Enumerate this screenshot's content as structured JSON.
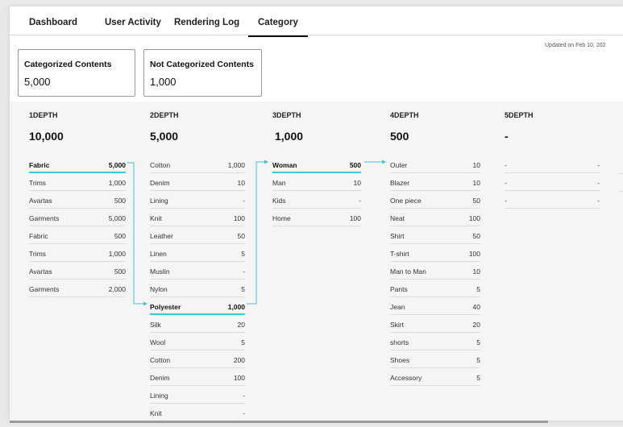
{
  "tabs": [
    "Dashboard",
    "User Activity",
    "Rendering Log",
    "Category"
  ],
  "updated": "Updated on Feb 10, 202",
  "cards": [
    {
      "title": "Categorized Contents",
      "value": "5,000"
    },
    {
      "title": "Not Categorized Contents",
      "value": "1,000"
    }
  ],
  "columns": [
    {
      "label": "1DEPTH",
      "total": "10,000",
      "rows": [
        {
          "name": "Fabric",
          "value": "5,000"
        },
        {
          "name": "Trims",
          "value": "1,000"
        },
        {
          "name": "Avartas",
          "value": "500"
        },
        {
          "name": "Garments",
          "value": "5,000"
        },
        {
          "name": "Fabric",
          "value": "500"
        },
        {
          "name": "Trims",
          "value": "1,000"
        },
        {
          "name": "Avartas",
          "value": "500"
        },
        {
          "name": "Garments",
          "value": "2,000"
        }
      ]
    },
    {
      "label": "2DEPTH",
      "total": "5,000",
      "rows": [
        {
          "name": "Cotton",
          "value": "1,000"
        },
        {
          "name": "Denim",
          "value": "10"
        },
        {
          "name": "Lining",
          "value": "-"
        },
        {
          "name": "Knit",
          "value": "100"
        },
        {
          "name": "Leather",
          "value": "50"
        },
        {
          "name": "Linen",
          "value": "5"
        },
        {
          "name": "Muslin",
          "value": "-"
        },
        {
          "name": "Nylon",
          "value": "5"
        },
        {
          "name": "Polyester",
          "value": "1,000"
        },
        {
          "name": "Silk",
          "value": "20"
        },
        {
          "name": "Wool",
          "value": "5"
        },
        {
          "name": "Cotton",
          "value": "200"
        },
        {
          "name": "Denim",
          "value": "100"
        },
        {
          "name": "Lining",
          "value": "-"
        },
        {
          "name": "Knit",
          "value": "-"
        }
      ]
    },
    {
      "label": "3DEPTH",
      "total": "1,000",
      "rows": [
        {
          "name": "Woman",
          "value": "500"
        },
        {
          "name": "Man",
          "value": "10"
        },
        {
          "name": "Kids",
          "value": "-"
        },
        {
          "name": "Home",
          "value": "100"
        }
      ]
    },
    {
      "label": "4DEPTH",
      "total": "500",
      "rows": [
        {
          "name": "Outer",
          "value": "10"
        },
        {
          "name": "Blazer",
          "value": "10"
        },
        {
          "name": "One piece",
          "value": "50"
        },
        {
          "name": "Neat",
          "value": "100"
        },
        {
          "name": "Shirt",
          "value": "50"
        },
        {
          "name": "T-shirt",
          "value": "100"
        },
        {
          "name": "Man to Man",
          "value": "10"
        },
        {
          "name": "Pants",
          "value": "5"
        },
        {
          "name": "Jean",
          "value": "40"
        },
        {
          "name": "Skirt",
          "value": "20"
        },
        {
          "name": "shorts",
          "value": "5"
        },
        {
          "name": "Shoes",
          "value": "5"
        },
        {
          "name": "Accessory",
          "value": "5"
        }
      ]
    },
    {
      "label": "5DEPTH",
      "total": "-",
      "rows": [
        {
          "name": "-",
          "value": "-"
        },
        {
          "name": "-",
          "value": "-"
        },
        {
          "name": "-",
          "value": "-"
        }
      ]
    }
  ],
  "accent_color": "#3ec6d8"
}
